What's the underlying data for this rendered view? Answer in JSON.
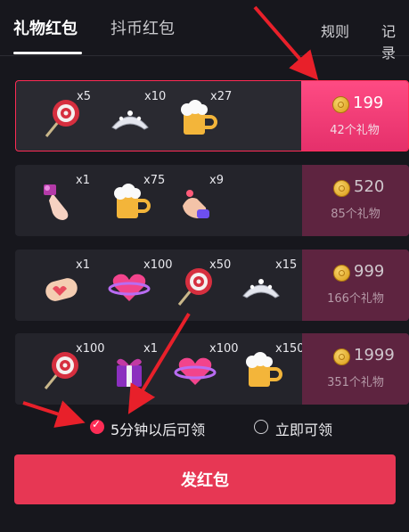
{
  "tabs": {
    "active": "礼物红包",
    "inactive": "抖币红包",
    "rules": "规则",
    "records": "记录"
  },
  "packages": [
    {
      "coins": "199",
      "gift_count": "42个礼物",
      "selected": true,
      "gifts": [
        {
          "icon": "lollipop-icon",
          "count": "x5"
        },
        {
          "icon": "tiara-icon",
          "count": "x10"
        },
        {
          "icon": "beer-mug-icon",
          "count": "x27"
        }
      ]
    },
    {
      "coins": "520",
      "gift_count": "85个礼物",
      "selected": false,
      "gifts": [
        {
          "icon": "pointing-hand-icon",
          "count": "x1"
        },
        {
          "icon": "beer-mug-icon",
          "count": "x75"
        },
        {
          "icon": "finger-heart-icon",
          "count": "x9"
        }
      ]
    },
    {
      "coins": "999",
      "gift_count": "166个礼物",
      "selected": false,
      "gifts": [
        {
          "icon": "glove-icon",
          "count": "x1"
        },
        {
          "icon": "heart-planet-icon",
          "count": "x100"
        },
        {
          "icon": "lollipop-icon",
          "count": "x50"
        },
        {
          "icon": "tiara-icon",
          "count": "x15"
        }
      ]
    },
    {
      "coins": "1999",
      "gift_count": "351个礼物",
      "selected": false,
      "gifts": [
        {
          "icon": "lollipop-icon",
          "count": "x100"
        },
        {
          "icon": "gift-box-icon",
          "count": "x1"
        },
        {
          "icon": "heart-planet-icon",
          "count": "x100"
        },
        {
          "icon": "beer-mug-icon",
          "count": "x150"
        }
      ]
    }
  ],
  "options": {
    "delayed": "5分钟以后可领",
    "immediate": "立即可领"
  },
  "send_button": "发红包",
  "colors": {
    "accent": "#fe2c55",
    "button": "#e73754",
    "selected_price": "#f0407a",
    "price_bg": "#5e2440",
    "coin": "#f1c232"
  }
}
